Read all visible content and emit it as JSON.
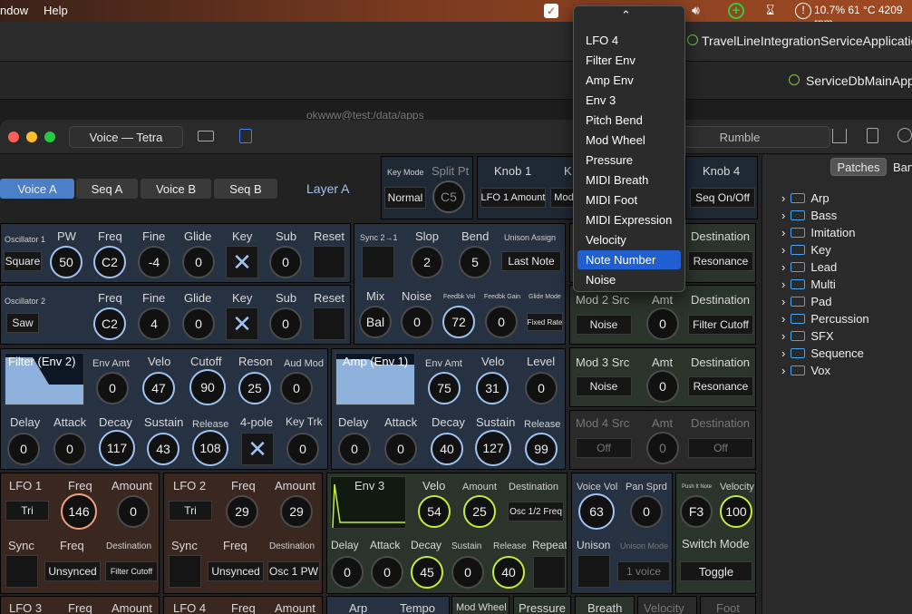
{
  "menubar": {
    "items": [
      "ndow",
      "Help"
    ],
    "status": "10.7% 61 °C 4209 rpm"
  },
  "bg_windows": {
    "win1_title": "TravelLineIntegrationServiceApplication",
    "win2_title": "ServiceDbMainApp",
    "win3_title": "okwww@test:/data/apps"
  },
  "window": {
    "title": "Voice — Tetra",
    "patch_name": "Rumble"
  },
  "tabs": [
    "Voice A",
    "Seq A",
    "Voice B",
    "Seq B"
  ],
  "layer_label": "Layer A",
  "keymode": {
    "label": "Key Mode",
    "value": "Normal",
    "split_label": "Split Pt",
    "split_value": "C5"
  },
  "knobs_top": [
    {
      "label": "Knob 1",
      "value": "LFO 1 Amount"
    },
    {
      "label": "K",
      "value": "Mod"
    },
    {
      "label": "Knob 4",
      "value": "Seq On/Off"
    }
  ],
  "osc1": {
    "title": "Oscillator 1",
    "shape": "Square",
    "labels": [
      "PW",
      "Freq",
      "Fine",
      "Glide",
      "Key",
      "Sub",
      "Reset"
    ],
    "pw": "50",
    "freq": "C2",
    "fine": "-4",
    "glide": "0",
    "sub": "0"
  },
  "osc2": {
    "title": "Oscillator 2",
    "shape": "Saw",
    "labels": [
      "Freq",
      "Fine",
      "Glide",
      "Key",
      "Sub",
      "Reset"
    ],
    "freq": "C2",
    "fine": "4",
    "glide": "0",
    "sub": "0"
  },
  "sync": {
    "label": "Sync 2→1",
    "slop_label": "Slop",
    "slop": "2",
    "bend_label": "Bend",
    "bend": "5",
    "unison_label": "Unison Assign",
    "unison": "Last Note"
  },
  "mix": {
    "mix_label": "Mix",
    "mix": "Bal",
    "noise_label": "Noise",
    "noise": "0",
    "fbvol_label": "Feedbk Vol",
    "fbvol": "72",
    "fbgain_label": "Feedbk Gain",
    "fbgain": "0",
    "glide_label": "Glide Mode",
    "glide": "Fixed Rate"
  },
  "mods": [
    {
      "src_label": "Mod 2 Src",
      "src": "Noise",
      "amt_label": "Amt",
      "amt": "0",
      "dest_label": "Destination",
      "dest": "Filter Cutoff"
    },
    {
      "src_label": "Mod 3 Src",
      "src": "Noise",
      "amt_label": "Amt",
      "amt": "0",
      "dest_label": "Destination",
      "dest": "Resonance"
    },
    {
      "src_label": "Mod 4 Src",
      "src": "Off",
      "amt_label": "Amt",
      "amt": "0",
      "dest_label": "Destination",
      "dest": "Off"
    }
  ],
  "mod1": {
    "dest_label": "Destination",
    "dest": "Resonance"
  },
  "filter": {
    "title": "Filter (Env 2)",
    "env_amt_label": "Env Amt",
    "env_amt": "0",
    "velo_label": "Velo",
    "velo": "47",
    "cutoff_label": "Cutoff",
    "cutoff": "90",
    "reson_label": "Reson",
    "reson": "25",
    "aud_label": "Aud Mod",
    "aud": "0",
    "delay_label": "Delay",
    "delay": "0",
    "attack_label": "Attack",
    "attack": "0",
    "decay_label": "Decay",
    "decay": "117",
    "sustain_label": "Sustain",
    "sustain": "43",
    "release_label": "Release",
    "release": "108",
    "pole_label": "4-pole",
    "keytrk_label": "Key Trk",
    "keytrk": "0"
  },
  "amp": {
    "title": "Amp (Env 1)",
    "env_amt_label": "Env Amt",
    "env_amt": "75",
    "velo_label": "Velo",
    "velo": "31",
    "level_label": "Level",
    "level": "0",
    "delay_label": "Delay",
    "delay": "0",
    "attack_label": "Attack",
    "attack": "0",
    "decay_label": "Decay",
    "decay": "40",
    "sustain_label": "Sustain",
    "sustain": "127",
    "release_label": "Release",
    "release": "99"
  },
  "lfo1": {
    "title": "LFO 1",
    "shape": "Tri",
    "freq_label": "Freq",
    "freq": "146",
    "amount_label": "Amount",
    "amount": "0",
    "sync_label": "Sync",
    "freq2_label": "Freq",
    "freq2": "Unsynced",
    "dest_label": "Destination",
    "dest": "Filter Cutoff"
  },
  "lfo2": {
    "title": "LFO 2",
    "shape": "Tri",
    "freq_label": "Freq",
    "freq": "29",
    "amount_label": "Amount",
    "amount": "29",
    "sync_label": "Sync",
    "freq2_label": "Freq",
    "freq2": "Unsynced",
    "dest_label": "Destination",
    "dest": "Osc 1 PW"
  },
  "env3": {
    "title": "Env 3",
    "velo_label": "Velo",
    "velo": "54",
    "amount_label": "Amount",
    "amount": "25",
    "dest_label": "Destination",
    "dest": "Osc 1/2 Freq",
    "delay_label": "Delay",
    "delay": "0",
    "attack_label": "Attack",
    "attack": "0",
    "decay_label": "Decay",
    "decay": "45",
    "sustain_label": "Sustain",
    "sustain": "0",
    "release_label": "Release",
    "release": "40",
    "repeat_label": "Repeat"
  },
  "voice": {
    "vol_label": "Voice Vol",
    "vol": "63",
    "pan_label": "Pan Sprd",
    "pan": "0",
    "unison_label": "Unison",
    "unison_mode_label": "Unison Mode",
    "unison_mode": "1 voice"
  },
  "push": {
    "label": "Push It Note",
    "value": "F3",
    "velocity_label": "Velocity",
    "velocity": "100",
    "switch_label": "Switch Mode",
    "switch": "Toggle"
  },
  "bottom": {
    "lfo3": "LFO 3",
    "freq": "Freq",
    "amount": "Amount",
    "lfo4": "LFO 4",
    "freq4": "Freq",
    "amount4": "Amount",
    "arp": "Arp",
    "tempo": "Tempo",
    "tabs": [
      "Mod Wheel",
      "Pressure",
      "Breath",
      "Velocity",
      "Foot"
    ]
  },
  "sidebar": {
    "tabs": [
      "Patches",
      "Ban"
    ],
    "folders": [
      "Arp",
      "Bass",
      "Imitation",
      "Key",
      "Lead",
      "Multi",
      "Pad",
      "Percussion",
      "SFX",
      "Sequence",
      "Vox"
    ]
  },
  "dropdown": {
    "items": [
      "LFO 4",
      "Filter Env",
      "Amp Env",
      "Env 3",
      "Pitch Bend",
      "Mod Wheel",
      "Pressure",
      "MIDI Breath",
      "MIDI Foot",
      "MIDI Expression",
      "Velocity",
      "Note Number",
      "Noise"
    ],
    "selected": "Note Number"
  }
}
